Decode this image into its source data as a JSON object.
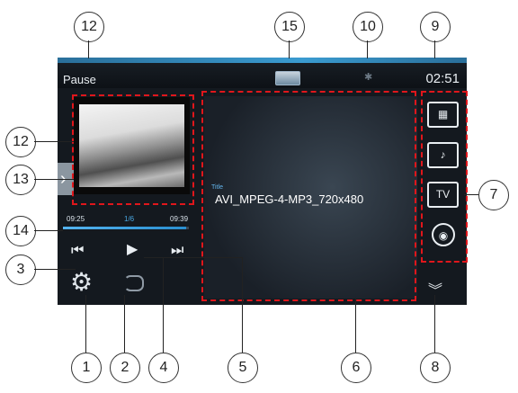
{
  "status": {
    "state": "Pause",
    "time": "02:51"
  },
  "video": {
    "title_label": "Title",
    "title": "AVI_MPEG-4-MP3_720x480"
  },
  "progress": {
    "elapsed": "09:25",
    "track": "1/6",
    "total": "09:39",
    "fraction": 0.98
  },
  "callouts": [
    "12",
    "15",
    "10",
    "9",
    "12",
    "13",
    "7",
    "14",
    "3",
    "1",
    "2",
    "4",
    "5",
    "6",
    "8"
  ],
  "icons": [
    "play-icon",
    "prev-icon",
    "next-icon",
    "gear-icon",
    "repeat-icon",
    "movie-icon",
    "music-icon",
    "tv-icon",
    "radio-icon",
    "chevrons-down-icon",
    "bluetooth-icon",
    "image-icon",
    "chevron-right-icon"
  ],
  "accent": "#3a9bd0"
}
